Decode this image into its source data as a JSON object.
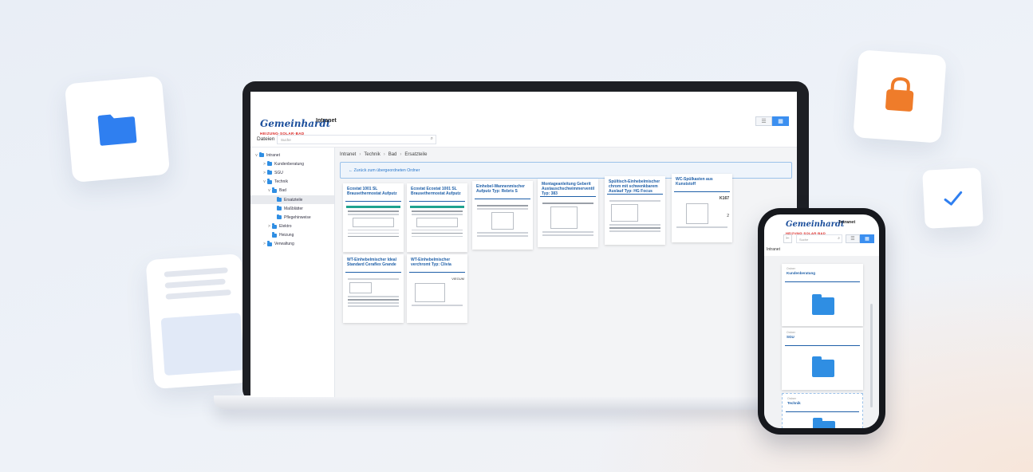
{
  "colors": {
    "accent": "#3b8ff0",
    "folder": "#2f8ee3",
    "lock": "#ef7c2a",
    "brand_blue": "#1c4f9c",
    "brand_red": "#d9231f",
    "teal": "#1fa38f"
  },
  "floating_icons": {
    "folder": "folder-icon",
    "lock": "lock-icon",
    "check": "check-icon",
    "doc": "document-icon"
  },
  "brand": {
    "logo": "Gemeinhardt",
    "tagline": "HEIZUNG·SOLAR·BAD",
    "title": "Intranet"
  },
  "toolbar": {
    "label": "Dateien",
    "search_placeholder": "Suche"
  },
  "sidebar": {
    "items": [
      {
        "label": "Intranet",
        "chevron": "v"
      },
      {
        "label": "Kundenberatung",
        "chevron": ">"
      },
      {
        "label": "SGU",
        "chevron": ">"
      },
      {
        "label": "Technik",
        "chevron": "v"
      },
      {
        "label": "Bad",
        "chevron": "v"
      },
      {
        "label": "Ersatzteile",
        "chevron": ""
      },
      {
        "label": "Maßblätter",
        "chevron": ""
      },
      {
        "label": "Pflegehinweise",
        "chevron": ""
      },
      {
        "label": "Elektro",
        "chevron": ">"
      },
      {
        "label": "Heizung",
        "chevron": ""
      },
      {
        "label": "Verwaltung",
        "chevron": ">"
      }
    ]
  },
  "breadcrumb": [
    "Intranet",
    "Technik",
    "Bad",
    "Ersatzteile"
  ],
  "back_label": "Zurück zum übergeordneten Ordner",
  "documents": [
    {
      "title": "Ecostat 1001 SL Brausethermostat Aufputz"
    },
    {
      "title": "Ecostat Ecostat 1001 SL Brausethermostat Aufputz"
    },
    {
      "title": "Einhebel-Wannenmischer Aufputz Typ: Rebris S"
    },
    {
      "title": "Montageanleitung Geberit Austauschschwimmerventil Typ: 383"
    },
    {
      "title": "Spültisch-Einhebelmischer chrom mit schwenkbarem Auslauf Typ: HG Focus M41"
    },
    {
      "title": "WC-Spülkasten aus Kunststoff",
      "thumb_label": "K167",
      "thumb_num": "2"
    },
    {
      "title": "WT-Einhebelmischer Ideal Standard Ceraflex Grande"
    },
    {
      "title": "WT-Einhebelmischer verchromt Typ: Clivia",
      "thumb_label": "VIEGUM"
    }
  ],
  "phone": {
    "search_placeholder": "Suche",
    "breadcrumb": "Intranet",
    "folders": [
      {
        "type": "Ordner",
        "name": "Kundenberatung"
      },
      {
        "type": "Ordner",
        "name": "SGU"
      },
      {
        "type": "Ordner",
        "name": "Technik"
      }
    ]
  }
}
